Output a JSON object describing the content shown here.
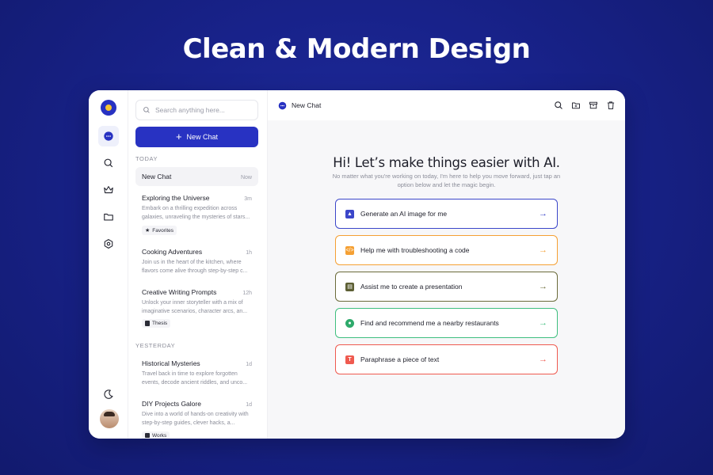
{
  "headline": "Clean & Modern Design",
  "colors": {
    "brand": "#2832c2",
    "background": "#18228a",
    "accent_yellow": "#f7c531"
  },
  "rail": {
    "items": [
      {
        "name": "chat-icon",
        "active": true
      },
      {
        "name": "search-icon",
        "active": false
      },
      {
        "name": "crown-icon",
        "active": false
      },
      {
        "name": "folder-icon",
        "active": false
      },
      {
        "name": "settings-icon",
        "active": false
      }
    ],
    "bottom": [
      {
        "name": "moon-icon"
      },
      {
        "name": "avatar"
      }
    ]
  },
  "sidebar": {
    "search_placeholder": "Search anything here...",
    "new_chat_label": "New Chat",
    "sections": [
      {
        "label": "TODAY",
        "chats": [
          {
            "title": "New Chat",
            "time": "Now"
          },
          {
            "title": "Exploring the Universe",
            "time": "3m",
            "desc": "Embark on a thrilling expedition across galaxies, unraveling the mysteries of stars...",
            "tag": "Favorites"
          },
          {
            "title": "Cooking Adventures",
            "time": "1h",
            "desc": "Join us in the heart of the kitchen, where flavors come alive through step-by-step c..."
          },
          {
            "title": "Creative Writing Prompts",
            "time": "12h",
            "desc": "Unlock your inner storyteller with a mix of imaginative scenarios, character arcs, an...",
            "tag": "Thesis"
          }
        ]
      },
      {
        "label": "YESTERDAY",
        "chats": [
          {
            "title": "Historical Mysteries",
            "time": "1d",
            "desc": "Travel back in time to explore forgotten events, decode ancient riddles, and unco..."
          },
          {
            "title": "DIY Projects Galore",
            "time": "1d",
            "desc": "Dive into a world of hands-on creativity with step-by-step guides, clever hacks, a...",
            "tag": "Works"
          }
        ]
      }
    ]
  },
  "main": {
    "topbar_title": "New Chat",
    "top_actions": [
      "search-icon",
      "folder-add-icon",
      "archive-icon",
      "trash-icon"
    ],
    "hero_title": "Hi! Let’s make things easier with AI.",
    "hero_subtitle": "No matter what you're working on today, I'm here to help you move forward, just tap an option below and let the magic begin.",
    "suggestions": [
      {
        "label": "Generate an AI image for me",
        "border": "#3b46c9",
        "icon_color": "#3b46c9",
        "arrow": "→"
      },
      {
        "label": "Help me with troubleshooting a code",
        "border": "#f5a033",
        "icon_color": "#f5a033",
        "arrow": "→"
      },
      {
        "label": "Assist me to create a presentation",
        "border": "#6b6b3a",
        "icon_color": "#5d5f34",
        "arrow": "→"
      },
      {
        "label": "Find and recommend me a nearby restaurants",
        "border": "#3fbf7f",
        "icon_color": "#2eaa6b",
        "arrow": "→"
      },
      {
        "label": "Paraphrase a piece of text",
        "border": "#ef5a4f",
        "icon_color": "#ef5a4f",
        "arrow": "→"
      }
    ]
  }
}
